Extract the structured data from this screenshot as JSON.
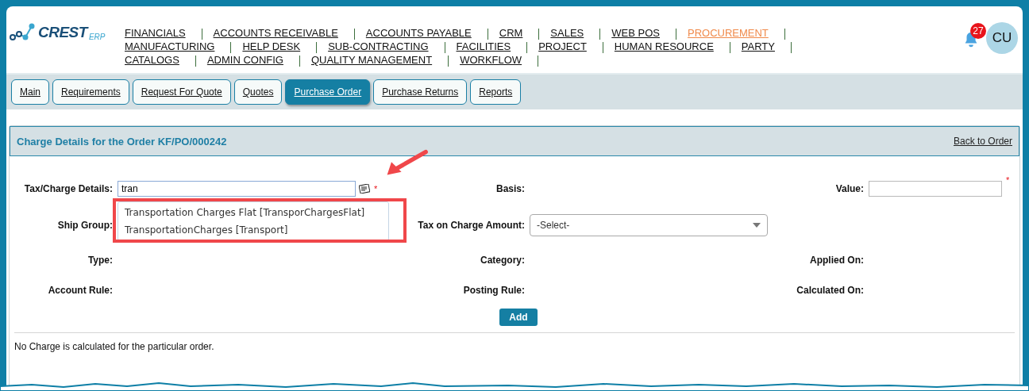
{
  "header": {
    "logo": {
      "name": "CREST",
      "suffix": "ERP"
    },
    "nav": [
      {
        "label": "FINANCIALS",
        "selected": false
      },
      {
        "label": "ACCOUNTS RECEIVABLE",
        "selected": false
      },
      {
        "label": "ACCOUNTS PAYABLE",
        "selected": false
      },
      {
        "label": "CRM",
        "selected": false
      },
      {
        "label": "SALES",
        "selected": false
      },
      {
        "label": "WEB POS",
        "selected": false
      },
      {
        "label": "PROCUREMENT",
        "selected": true
      },
      {
        "label": "MANUFACTURING",
        "selected": false
      },
      {
        "label": "HELP DESK",
        "selected": false
      },
      {
        "label": "SUB-CONTRACTING",
        "selected": false
      },
      {
        "label": "FACILITIES",
        "selected": false
      },
      {
        "label": "PROJECT",
        "selected": false
      },
      {
        "label": "HUMAN RESOURCE",
        "selected": false
      },
      {
        "label": "PARTY",
        "selected": false
      },
      {
        "label": "CATALOGS",
        "selected": false
      },
      {
        "label": "ADMIN CONFIG",
        "selected": false
      },
      {
        "label": "QUALITY MANAGEMENT",
        "selected": false
      },
      {
        "label": "WORKFLOW",
        "selected": false
      }
    ],
    "notifications": {
      "count": "27"
    },
    "avatar": {
      "initials": "CU"
    }
  },
  "tabs": [
    {
      "label": "Main",
      "selected": false
    },
    {
      "label": "Requirements",
      "selected": false
    },
    {
      "label": "Request For Quote",
      "selected": false
    },
    {
      "label": "Quotes",
      "selected": false
    },
    {
      "label": "Purchase Order",
      "selected": true
    },
    {
      "label": "Purchase Returns",
      "selected": false
    },
    {
      "label": "Reports",
      "selected": false
    }
  ],
  "panel": {
    "title": "Charge Details for the Order KF/PO/000242",
    "back_link": "Back to Order",
    "fields": [
      {
        "label": "Tax/Charge Details:",
        "kind": "lookup",
        "value": "tran",
        "required_mark": "*"
      },
      {
        "label": "Basis:",
        "kind": "readonly"
      },
      {
        "label": "Value:",
        "kind": "input",
        "required_mark": "*"
      },
      {
        "label": "Ship Group:",
        "kind": "readonly"
      },
      {
        "label": "Tax on Charge Amount:",
        "kind": "select",
        "value": "-Select-"
      },
      {
        "kind": "blank"
      },
      {
        "label": "Type:",
        "kind": "readonly"
      },
      {
        "label": "Category:",
        "kind": "readonly"
      },
      {
        "label": "Applied On:",
        "kind": "readonly"
      },
      {
        "label": "Account Rule:",
        "kind": "readonly"
      },
      {
        "label": "Posting Rule:",
        "kind": "readonly"
      },
      {
        "label": "Calculated On:",
        "kind": "readonly"
      }
    ],
    "suggestions": [
      "Transportation Charges Flat [TransporChargesFlat]",
      "TransportationCharges [Transport]"
    ],
    "add_button": "Add",
    "message": "No Charge is calculated for the particular order."
  }
}
